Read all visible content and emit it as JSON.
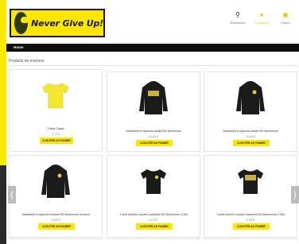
{
  "header": {
    "logo_text": "Never Give Up!",
    "actions": [
      {
        "label": "Recherche",
        "icon": "search-icon"
      },
      {
        "label": "Connexion",
        "icon": "user-icon"
      },
      {
        "label": "Panier",
        "icon": "cart-icon"
      }
    ]
  },
  "nav": {
    "home_label": "Home"
  },
  "section": {
    "title": "Produits du moment"
  },
  "products": [
    {
      "name": "T-shirt Catalo",
      "price": "5,70 €",
      "button": "AJOUTER AU PANIER",
      "color": "#f3e631",
      "kind": "tshirt"
    },
    {
      "name": "Sweatshirt à capuche adulte BG Bonhimme",
      "price": "25,60 €",
      "button": "AJOUTER AU PANIER",
      "color": "#1b1b1b",
      "kind": "hoodie-print"
    },
    {
      "name": "Sweatshirt à capuche adulte BG Bonhimme",
      "price": "25,60 €",
      "button": "AJOUTER AU PANIER",
      "color": "#1b1b1b",
      "kind": "hoodie-logo"
    },
    {
      "name": "Sweatshirt à capuche enfants BG Bonhimme écureuil",
      "price": "19,50 €",
      "button": "AJOUTER AU PANIER",
      "color": "#1b1b1b",
      "kind": "hoodie-logo"
    },
    {
      "name": "T-shirt enfants courtes manches BG Bonhimme L'Oeil",
      "price": "8,20 €",
      "button": "AJOUTER AU PANIER",
      "color": "#1b1b1b",
      "kind": "tshirt-logo"
    },
    {
      "name": "T-shirt homme courtes manches BG Bonhimme L'Oeil",
      "price": "9,50 €",
      "button": "AJOUTER AU PANIER",
      "color": "#1b1b1b",
      "kind": "tshirt-print"
    }
  ],
  "colors": {
    "brand_yellow": "#ffe600",
    "nav_black": "#0d0d0d",
    "accent": "#f2c200"
  }
}
